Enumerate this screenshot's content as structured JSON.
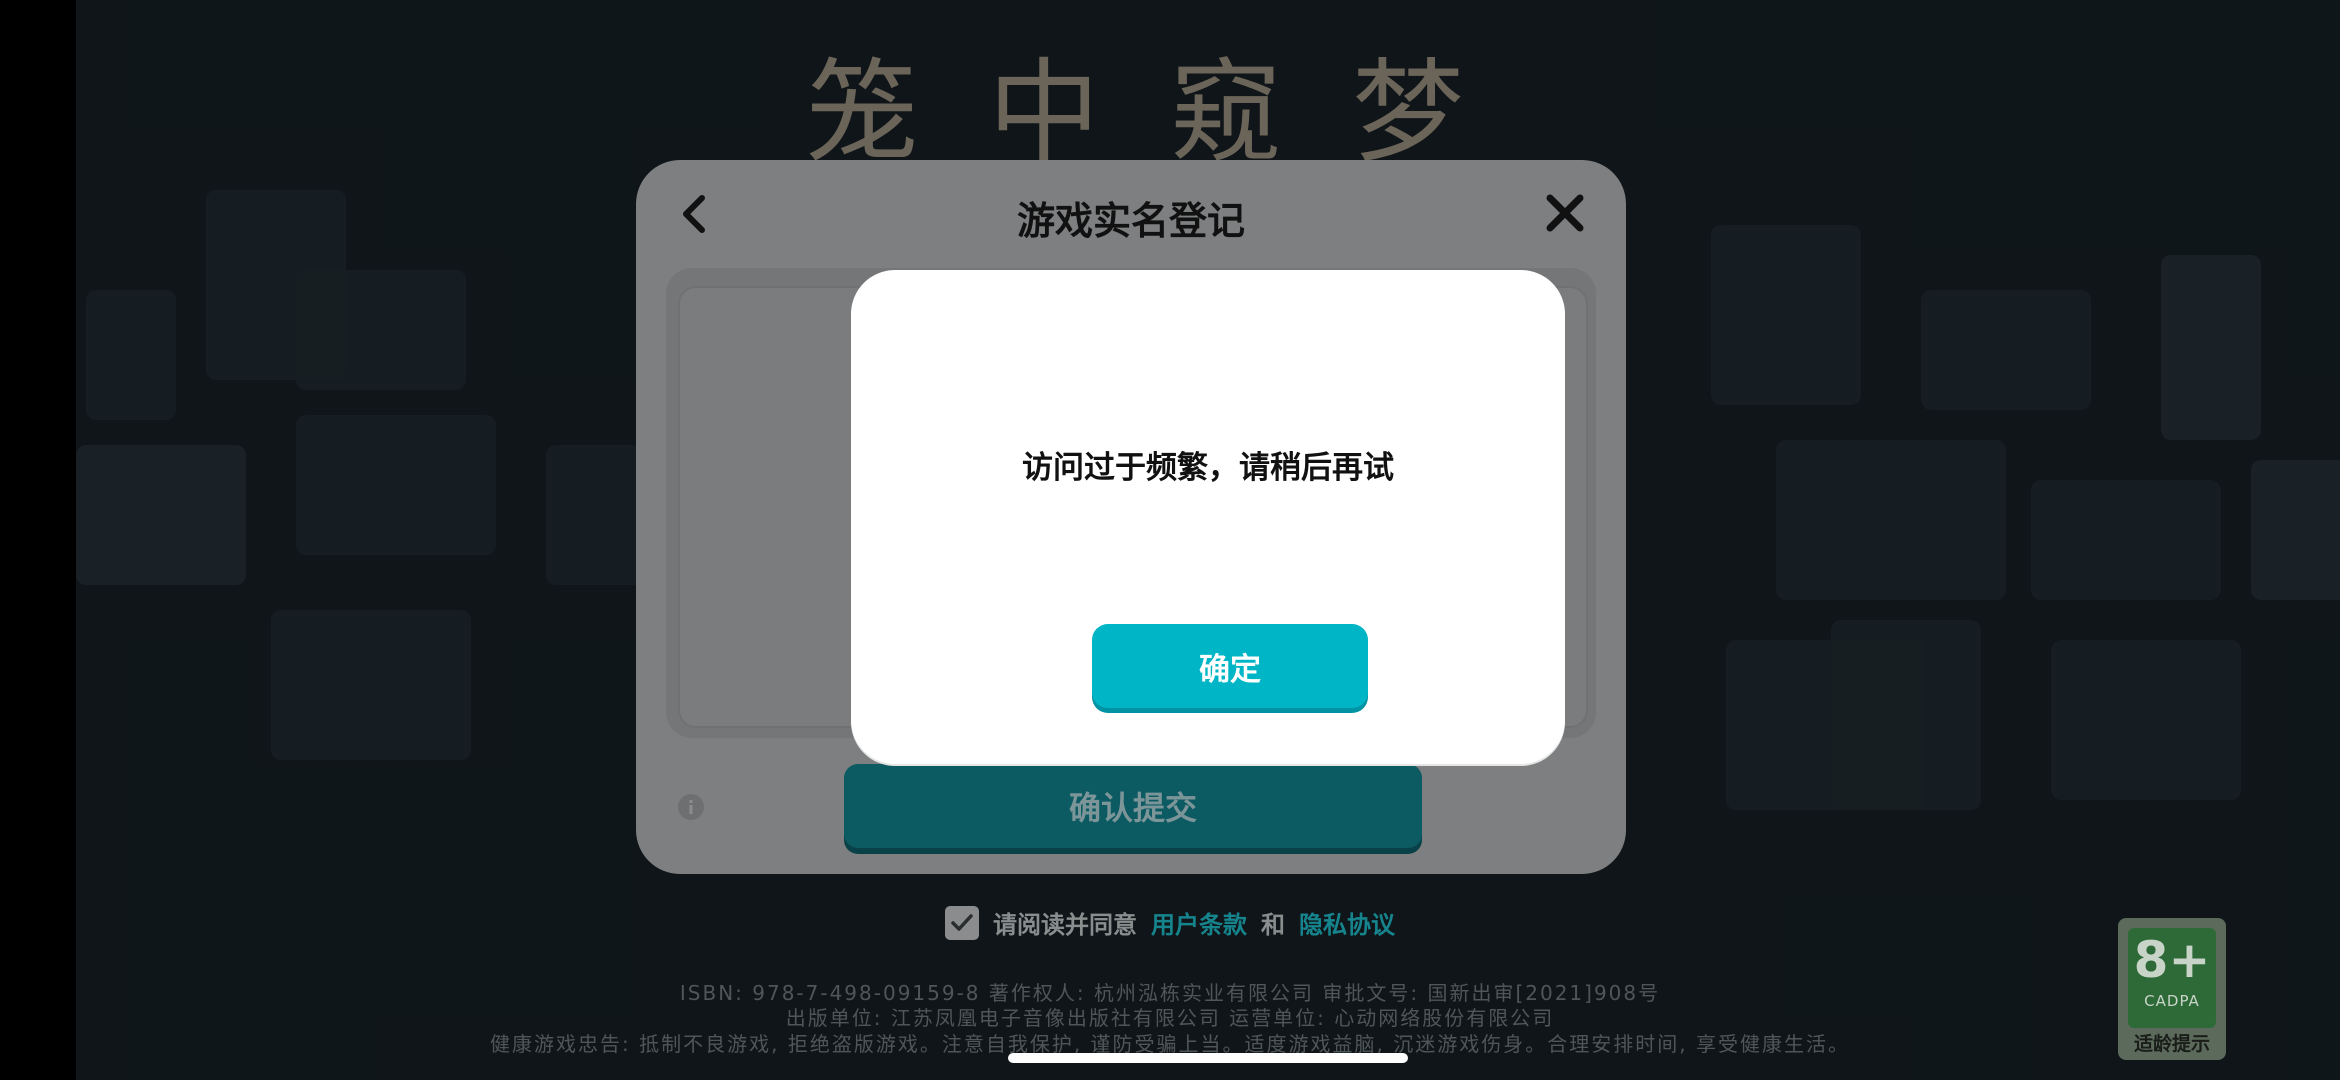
{
  "game": {
    "title": "笼中窥梦"
  },
  "panel": {
    "title": "游戏实名登记",
    "back_icon": "chevron-left-icon",
    "close_icon": "close-icon",
    "info_icon": "info-icon",
    "submit_label": "确认提交"
  },
  "agreement": {
    "prefix": "请阅读并同意",
    "terms_link": "用户条款",
    "and": "和",
    "privacy_link": "隐私协议"
  },
  "footer": {
    "line1": "ISBN: 978-7-498-09159-8    著作权人: 杭州泓栋实业有限公司 审批文号: 国新出审[2021]908号",
    "line2": "出版单位: 江苏凤凰电子音像出版社有限公司    运营单位: 心动网络股份有限公司",
    "line3": "健康游戏忠告: 抵制不良游戏, 拒绝盗版游戏。注意自我保护, 谨防受骗上当。适度游戏益脑, 沉迷游戏伤身。合理安排时间, 享受健康生活。"
  },
  "age_rating": {
    "value": "8+",
    "org": "CADPA",
    "label": "适龄提示"
  },
  "dialog": {
    "message": "访问过于频繁，请稍后再试",
    "confirm_label": "确定"
  },
  "colors": {
    "accent": "#00b5c6",
    "link": "#16848d",
    "background": "#141c20"
  }
}
